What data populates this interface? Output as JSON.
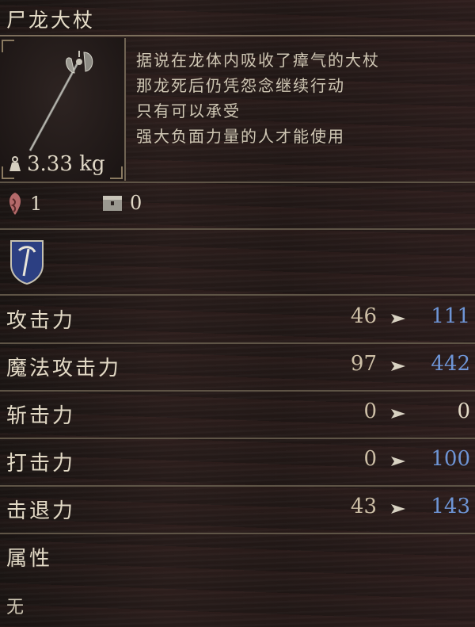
{
  "item": {
    "name": "尸龙大杖",
    "weight": "3.33 kg",
    "description": [
      "据说在龙体内吸收了瘴气的大杖",
      "那龙死后仍凭怨念继续行动",
      "只有可以承受",
      "强大负面力量的人才能使用"
    ]
  },
  "requirements": {
    "arc_value": "1",
    "chest_value": "0"
  },
  "stats": [
    {
      "label": "攻击力",
      "old": "46",
      "new": "111",
      "changed": true
    },
    {
      "label": "魔法攻击力",
      "old": "97",
      "new": "442",
      "changed": true
    },
    {
      "label": "斩击力",
      "old": "0",
      "new": "0",
      "changed": false
    },
    {
      "label": "打击力",
      "old": "0",
      "new": "100",
      "changed": true
    },
    {
      "label": "击退力",
      "old": "43",
      "new": "143",
      "changed": true
    }
  ],
  "attribute": {
    "label": "属性",
    "value": "无"
  },
  "colors": {
    "increase": "#6e95d6",
    "text": "#e3dac6"
  },
  "icons": [
    "weapon-staff-icon",
    "weight-icon",
    "arc-requirement-icon",
    "storage-chest-icon",
    "affinity-badge-icon",
    "arrow-icon"
  ]
}
